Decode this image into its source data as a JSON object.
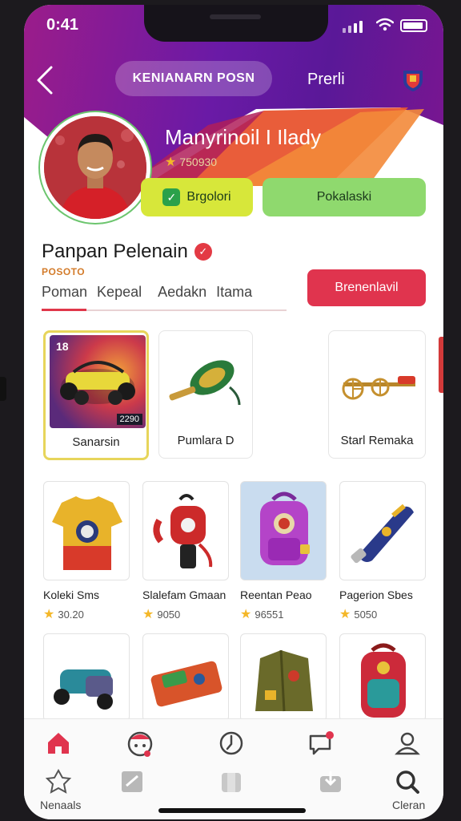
{
  "status_bar": {
    "time": "0:41"
  },
  "header": {
    "pill_tab": "KENIANARN POSN",
    "plain_tab": "Prerli"
  },
  "profile": {
    "name": "Manyrinoil I Ilady",
    "rating": "750930",
    "btn_primary": "Brgolori",
    "btn_secondary": "Pokalaski"
  },
  "section": {
    "title": "Panpan Pelenain",
    "subtitle": "POSOTO",
    "tabs": [
      "Poman",
      "Kepeal",
      "Aedakn",
      "Itama"
    ],
    "cta": "Brenenlavil"
  },
  "featured_cards": [
    {
      "label": "Sanarsin",
      "badge": "18",
      "tag": "2290"
    },
    {
      "label": "Pumlara D"
    },
    {
      "label": "Starl Remaka"
    }
  ],
  "products": [
    {
      "name": "Koleki Sms",
      "price": "30.20"
    },
    {
      "name": "Slalefam Gmaan",
      "price": "9050"
    },
    {
      "name": "Reentan Peao",
      "price": "96551"
    },
    {
      "name": "Pagerion Sbes",
      "price": "5050"
    }
  ],
  "bottom_nav": {
    "label_home": "Nenaals",
    "label_search": "Cleran"
  },
  "colors": {
    "accent_red": "#e0344e",
    "header_purple": "#6a1aa6",
    "button_yellow": "#d7e73a",
    "button_green": "#8fd96e"
  }
}
